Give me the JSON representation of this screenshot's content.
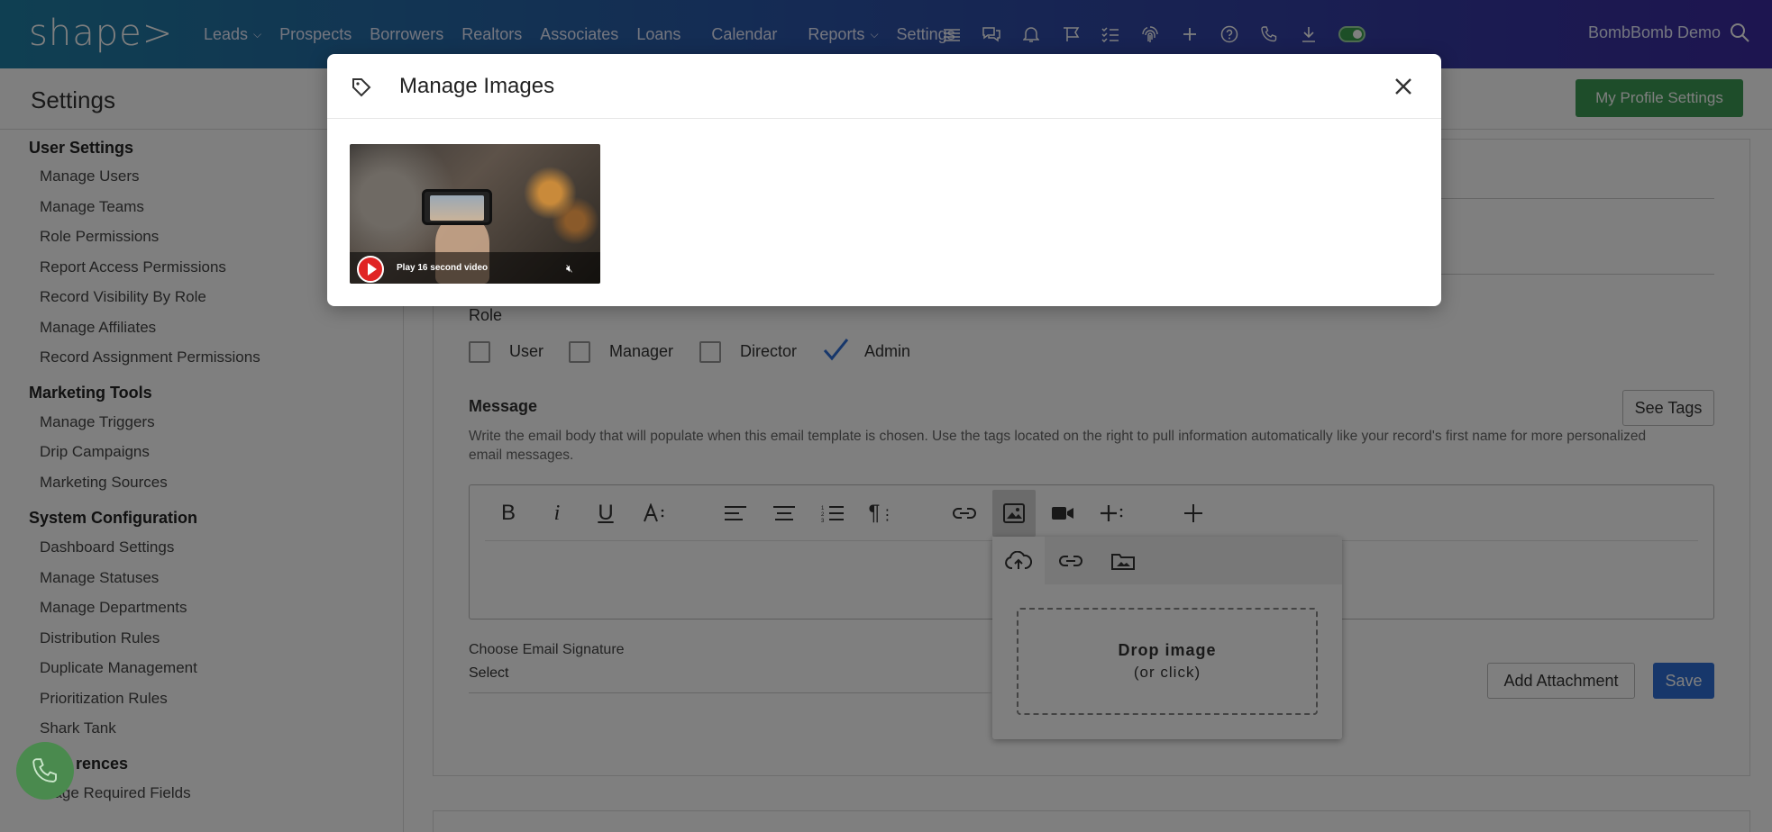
{
  "topbar": {
    "logo": "shape>",
    "nav": [
      {
        "label": "Leads",
        "dropdown": true
      },
      {
        "label": "Prospects",
        "dropdown": false
      },
      {
        "label": "Borrowers",
        "dropdown": false
      },
      {
        "label": "Realtors",
        "dropdown": false
      },
      {
        "label": "Associates",
        "dropdown": false
      },
      {
        "label": "Loans",
        "dropdown": false
      },
      {
        "label": "Calendar",
        "dropdown": false
      },
      {
        "label": "Reports",
        "dropdown": true
      },
      {
        "label": "Settings",
        "dropdown": false
      }
    ],
    "icons": [
      "list-icon",
      "chat-icon",
      "bell-icon",
      "flag-icon",
      "checklist-icon",
      "fingerprint-icon",
      "plus-icon",
      "help-icon",
      "phone-icon",
      "download-icon",
      "toggle-switch"
    ],
    "user_name": "BombBomb Demo"
  },
  "header": {
    "title": "Settings",
    "profile_button": "My Profile Settings"
  },
  "sidebar": {
    "sections": [
      {
        "heading": "User Settings",
        "items": [
          "Manage Users",
          "Manage Teams",
          "Role Permissions",
          "Report Access Permissions",
          "Record Visibility By Role",
          "Manage Affiliates",
          "Record Assignment Permissions"
        ]
      },
      {
        "heading": "Marketing Tools",
        "items": [
          "Manage Triggers",
          "Drip Campaigns",
          "Marketing Sources"
        ]
      },
      {
        "heading": "System Configuration",
        "items": [
          "Dashboard Settings",
          "Manage Statuses",
          "Manage Departments",
          "Distribution Rules",
          "Duplicate Management",
          "Prioritization Rules",
          "Shark Tank"
        ]
      },
      {
        "heading": "rences",
        "items": [
          "nage Required Fields"
        ]
      }
    ]
  },
  "form": {
    "role_label": "Role",
    "roles": [
      {
        "label": "User",
        "checked": false
      },
      {
        "label": "Manager",
        "checked": false
      },
      {
        "label": "Director",
        "checked": false
      },
      {
        "label": "Admin",
        "checked": true
      }
    ],
    "message_label": "Message",
    "message_description": "Write the email body that will populate when this email template is chosen. Use the tags located on the right to pull information automatically like your record's first name for more personalized email messages.",
    "see_tags": "See Tags",
    "toolbar": [
      "bold-icon",
      "italic-icon",
      "underline-icon",
      "font-size-icon",
      "align-left-icon",
      "align-center-icon",
      "ordered-list-icon",
      "paragraph-icon",
      "link-icon",
      "image-icon",
      "video-icon",
      "insert-more-icon",
      "add-icon"
    ],
    "image_popup": {
      "tabs": [
        "upload-icon",
        "link-icon",
        "folder-image-icon"
      ],
      "drop_title": "Drop image",
      "drop_sub": "(or click)"
    },
    "signature_label": "Choose Email Signature",
    "signature_value": "Select",
    "add_attachment": "Add Attachment",
    "save": "Save"
  },
  "modal": {
    "title": "Manage Images",
    "images": [
      {
        "caption": "Play 16 second video"
      }
    ]
  },
  "colors": {
    "save": "#2f6fd6",
    "profile_button": "#3d9a54",
    "fab": "#4a8a4e",
    "play": "#e02424"
  }
}
